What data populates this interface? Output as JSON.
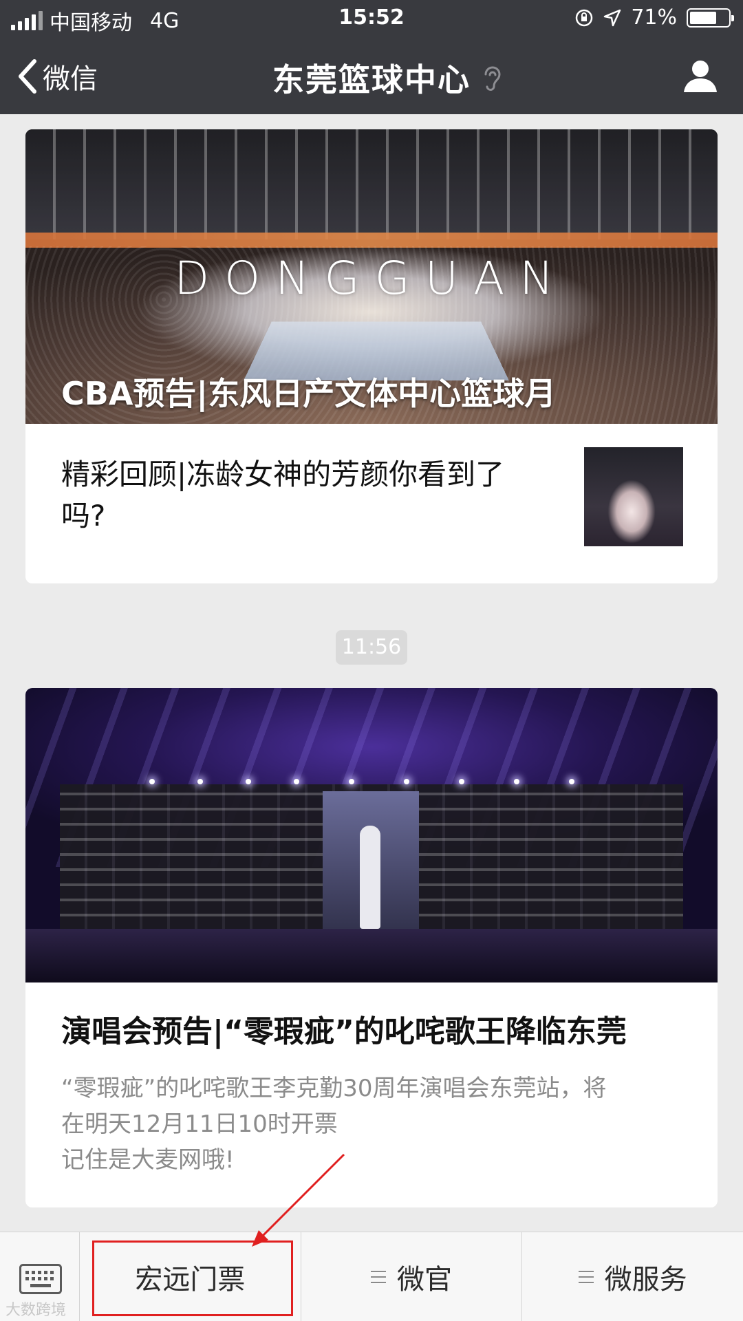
{
  "status_bar": {
    "carrier": "中国移动",
    "network": "4G",
    "time": "15:52",
    "battery": "71%",
    "battery_level": 0.71
  },
  "nav": {
    "back_label": "微信",
    "title": "东莞篮球中心"
  },
  "article1": {
    "hero_brand": "DONGGUAN",
    "hero_title": "CBA预告|东风日产文体中心篮球月",
    "sub_title": "精彩回顾|冻龄女神的芳颜你看到了吗?"
  },
  "timestamp": "11:56",
  "article2": {
    "title": "演唱会预告|“零瑕疵”的叱咤歌王降临东莞",
    "desc_line1": "“零瑕疵”的叱咤歌王李克勤30周年演唱会东莞站，将",
    "desc_line2": "在明天12月11日10时开票",
    "desc_line3": "记住是大麦网哦!"
  },
  "menu": {
    "items": [
      {
        "label": "宏远门票"
      },
      {
        "label": "微官"
      },
      {
        "label": "微服务"
      }
    ]
  },
  "watermark": "大数跨境",
  "colors": {
    "nav_bg": "#393a3f",
    "highlight": "#e02020",
    "page_bg": "#ebebeb"
  }
}
